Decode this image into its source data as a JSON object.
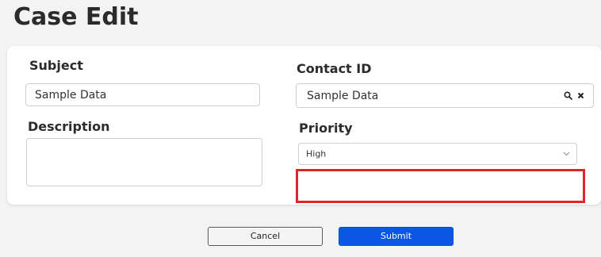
{
  "page": {
    "title": "Case Edit"
  },
  "form": {
    "subject": {
      "label": "Subject",
      "value": "Sample Data"
    },
    "contact_id": {
      "label": "Contact ID",
      "value": "Sample Data",
      "search_icon": "search-icon",
      "clear_icon": "close-icon"
    },
    "description": {
      "label": "Description",
      "value": ""
    },
    "priority": {
      "label": "Priority",
      "selected": "High",
      "dropdown_icon": "chevron-down-icon"
    }
  },
  "highlight": {
    "color": "#e0262b"
  },
  "actions": {
    "cancel_label": "Cancel",
    "submit_label": "Submit",
    "submit_color": "#0b57e3"
  }
}
